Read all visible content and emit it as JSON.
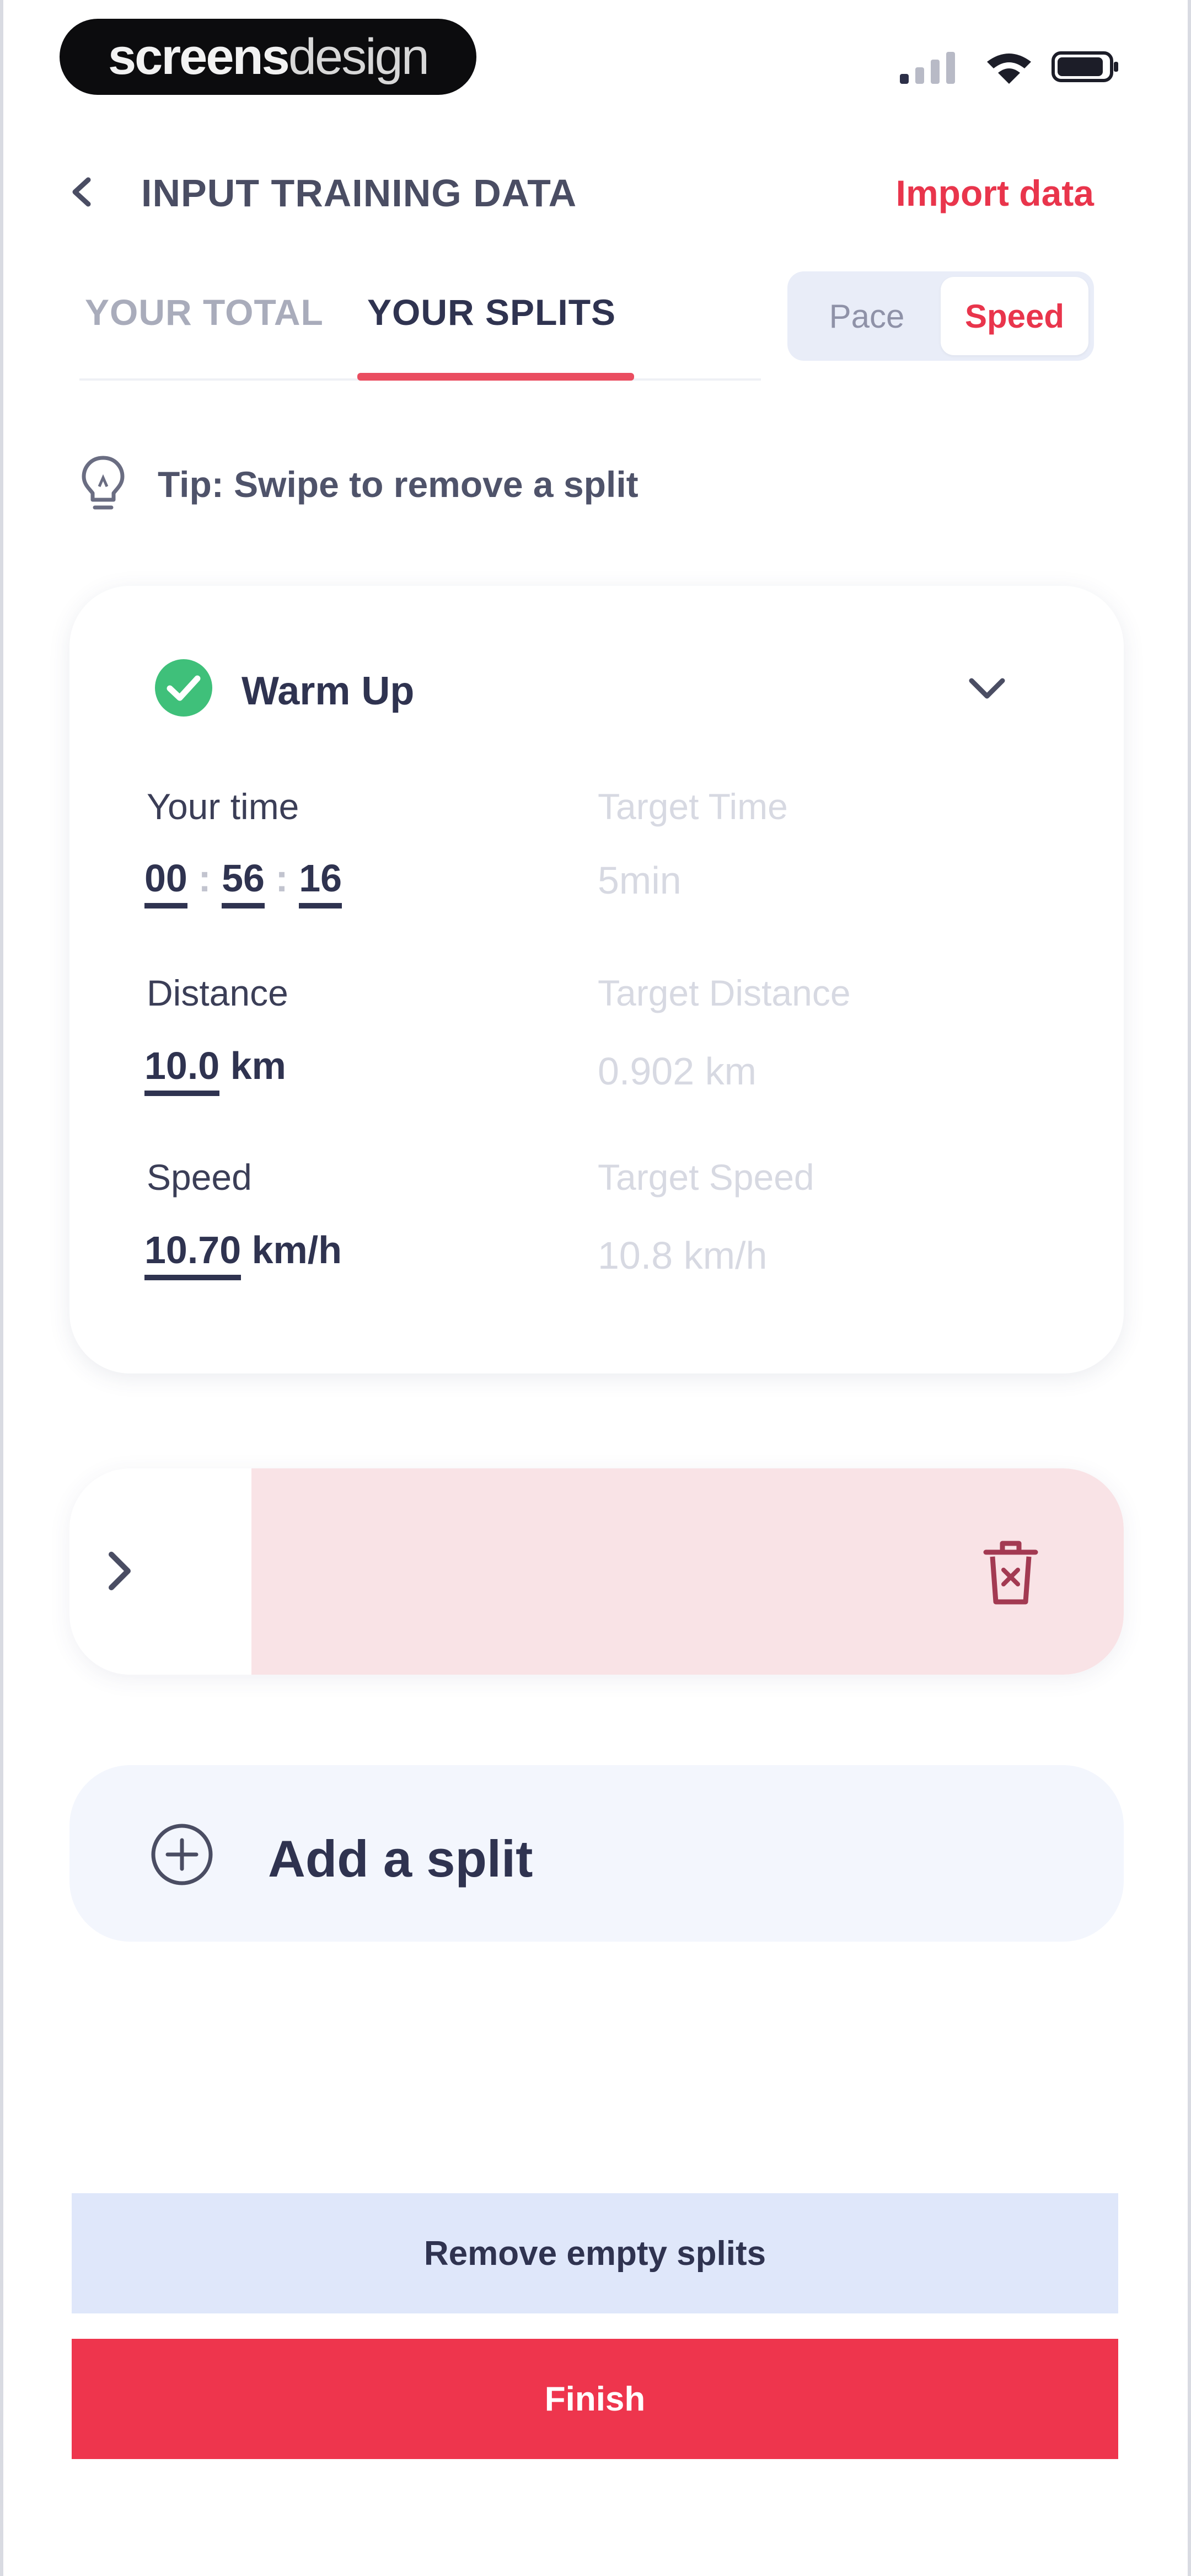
{
  "status_bar": {
    "brand_part1": "screens",
    "brand_part2": "design"
  },
  "header": {
    "title": "INPUT TRAINING DATA",
    "import_label": "Import data"
  },
  "tabs": [
    {
      "label": "YOUR TOTAL",
      "active": false
    },
    {
      "label": "YOUR SPLITS",
      "active": true
    }
  ],
  "unit_toggle": {
    "options": [
      "Pace",
      "Speed"
    ],
    "selected": "Speed"
  },
  "tip": {
    "text": "Tip: Swipe to remove a split"
  },
  "split_card": {
    "title": "Warm Up",
    "your_time_label": "Your time",
    "time_hours": "00",
    "time_minutes": "56",
    "time_seconds": "16",
    "target_time_label": "Target Time",
    "target_time_value": "5min",
    "distance_label": "Distance",
    "distance_value": "10.0",
    "distance_unit": "km",
    "target_distance_label": "Target Distance",
    "target_distance_value": "0.902 km",
    "speed_label": "Speed",
    "speed_value": "10.70",
    "speed_unit": "km/h",
    "target_speed_label": "Target Speed",
    "target_speed_value": "10.8 km/h"
  },
  "add_split": {
    "label": "Add a split"
  },
  "buttons": {
    "remove_empty": "Remove empty splits",
    "finish": "Finish"
  },
  "colors": {
    "accent": "#ee354d",
    "primary_text": "#2f3350",
    "success": "#3fc07a",
    "soft_blue": "#dfe7fa"
  }
}
